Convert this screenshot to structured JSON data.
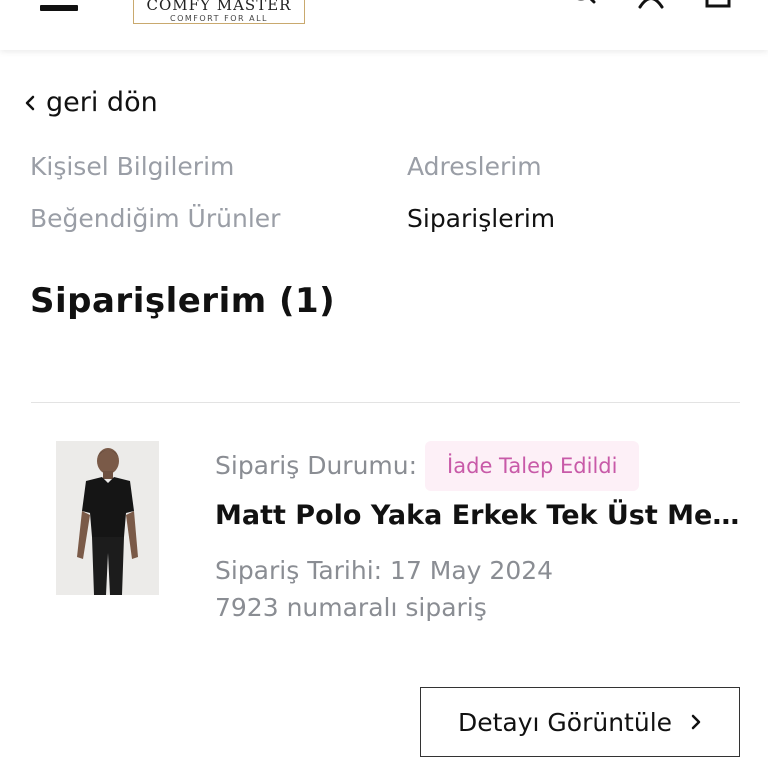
{
  "header": {
    "logo_main": "COMFY MASTER",
    "logo_sub": "COMFORT FOR ALL",
    "icons": [
      "menu-icon",
      "search-icon",
      "user-icon",
      "cart-icon"
    ]
  },
  "nav": {
    "back_label": "geri dön"
  },
  "account_menu": {
    "personal_info": "Kişisel Bilgilerim",
    "addresses": "Adreslerim",
    "liked_products": "Beğendiğim Ürünler",
    "orders": "Siparişlerim"
  },
  "page": {
    "title": "Siparişlerim (1)"
  },
  "order": {
    "status_label": "Sipariş Durumu:",
    "status_value": "İade Talep Edildi",
    "product_name": "Matt Polo Yaka Erkek Tek Üst Medikal Forma",
    "date_text": "Sipariş Tarihi: 17 May 2024",
    "number_text": "7923 numaralı sipariş",
    "detail_button": "Detayı Görüntüle"
  },
  "colors": {
    "muted_text": "#9a9ea6",
    "status_badge_bg": "#fdf0f7",
    "status_badge_text": "#c85aa8",
    "logo_gold": "#c9a96e"
  }
}
